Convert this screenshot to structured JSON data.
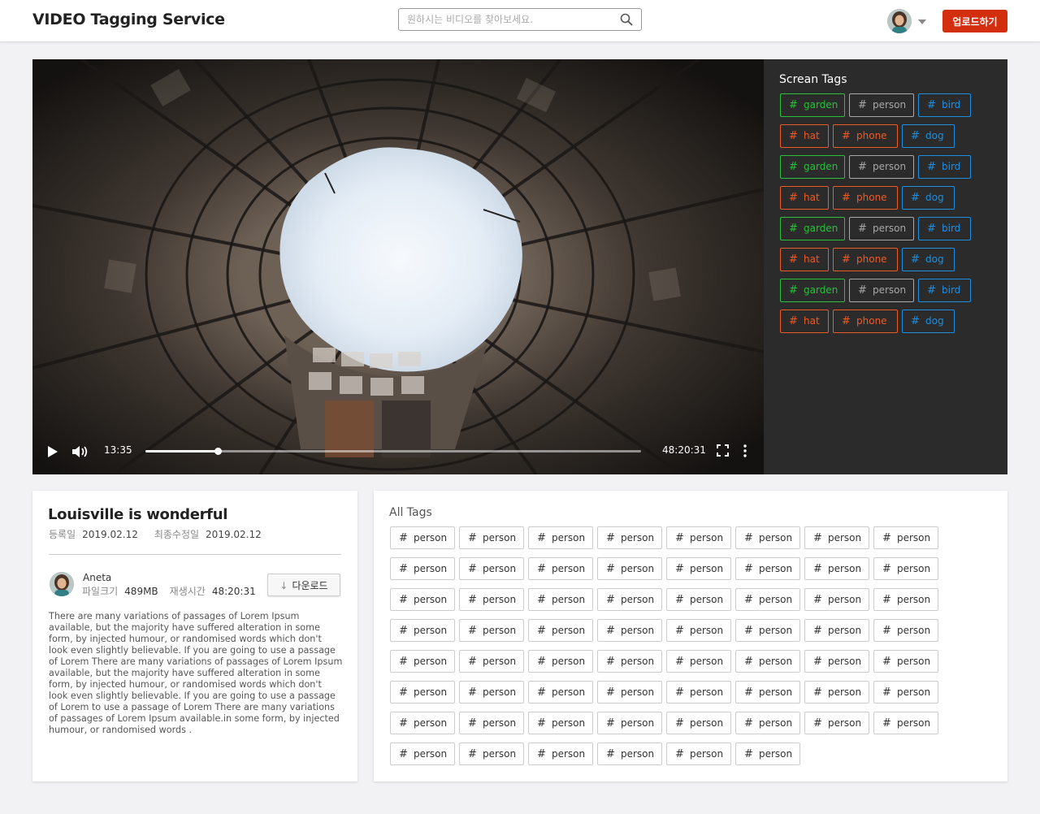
{
  "header": {
    "logo": "VIDEO Tagging Service",
    "search_placeholder": "원하시는 비디오를 찾아보세요.",
    "upload_label": "업로드하기"
  },
  "player": {
    "current_time": "13:35",
    "total_time": "48:20:31",
    "progress_fraction": 0.146
  },
  "screen_tags": {
    "title": "Screan Tags",
    "colors": {
      "green": "#27c23a",
      "gray": "#a8a8a8",
      "blue": "#1e8fe0",
      "orange": "#f05a24"
    },
    "rows": [
      [
        {
          "label": "garden",
          "color": "green"
        },
        {
          "label": "person",
          "color": "gray"
        },
        {
          "label": "bird",
          "color": "blue"
        }
      ],
      [
        {
          "label": "hat",
          "color": "orange"
        },
        {
          "label": "phone",
          "color": "orange"
        },
        {
          "label": "dog",
          "color": "blue"
        }
      ],
      [
        {
          "label": "garden",
          "color": "green"
        },
        {
          "label": "person",
          "color": "gray"
        },
        {
          "label": "bird",
          "color": "blue"
        }
      ],
      [
        {
          "label": "hat",
          "color": "orange"
        },
        {
          "label": "phone",
          "color": "orange"
        },
        {
          "label": "dog",
          "color": "blue"
        }
      ],
      [
        {
          "label": "garden",
          "color": "green"
        },
        {
          "label": "person",
          "color": "gray"
        },
        {
          "label": "bird",
          "color": "blue"
        }
      ],
      [
        {
          "label": "hat",
          "color": "orange"
        },
        {
          "label": "phone",
          "color": "orange"
        },
        {
          "label": "dog",
          "color": "blue"
        }
      ],
      [
        {
          "label": "garden",
          "color": "green"
        },
        {
          "label": "person",
          "color": "gray"
        },
        {
          "label": "bird",
          "color": "blue"
        }
      ],
      [
        {
          "label": "hat",
          "color": "orange"
        },
        {
          "label": "phone",
          "color": "orange"
        },
        {
          "label": "dog",
          "color": "blue"
        }
      ]
    ]
  },
  "info": {
    "title": "Louisville is wonderful",
    "registered_label": "등록일",
    "registered_value": "2019.02.12",
    "modified_label": "최종수정일",
    "modified_value": "2019.02.12",
    "user_name": "Aneta",
    "filesize_label": "파일크기",
    "filesize_value": "489MB",
    "duration_label": "재생시간",
    "duration_value": "48:20:31",
    "download_label": "다운로드",
    "description": "There are many variations of passages of Lorem Ipsum available, but the majority have suffered alteration in some form, by injected humour, or randomised words which don't look even slightly believable. If you are going to use a passage of Lorem There are many variations of passages of Lorem Ipsum available, but the majority have suffered alteration in some form, by injected humour, or randomised words which don't look even slightly believable. If you are going to use a passage of Lorem  to use a passage of Lorem There are many variations of passages of Lorem Ipsum available.in some form, by injected humour, or randomised words ."
  },
  "all_tags": {
    "title": "All Tags",
    "tags": [
      "person",
      "person",
      "person",
      "person",
      "person",
      "person",
      "person",
      "person",
      "person",
      "person",
      "person",
      "person",
      "person",
      "person",
      "person",
      "person",
      "person",
      "person",
      "person",
      "person",
      "person",
      "person",
      "person",
      "person",
      "person",
      "person",
      "person",
      "person",
      "person",
      "person",
      "person",
      "person",
      "person",
      "person",
      "person",
      "person",
      "person",
      "person",
      "person",
      "person",
      "person",
      "person",
      "person",
      "person",
      "person",
      "person",
      "person",
      "person",
      "person",
      "person",
      "person",
      "person",
      "person",
      "person",
      "person",
      "person",
      "person",
      "person",
      "person",
      "person",
      "person",
      "person"
    ]
  }
}
